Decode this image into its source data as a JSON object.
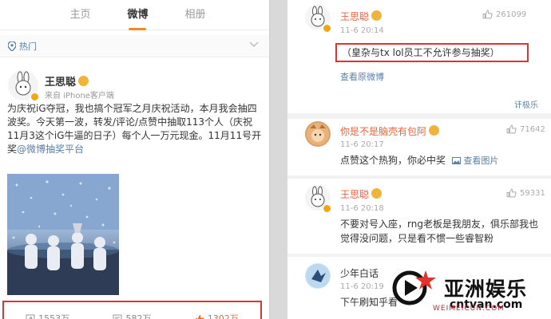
{
  "tabs": [
    "主页",
    "微博",
    "相册"
  ],
  "hot_label": "热门",
  "post": {
    "author": "王思聪",
    "source": "来自 iPhone客户端",
    "text_main": "为庆祝iG夺冠，我也搞个冠军之月庆祝活动，本月我会抽四波奖。今天第一波，转发/评论/点赞中抽取113个人（庆祝11月3这个iG牛逼的日子）每个人一万元现金。11月11号开奖",
    "text_link": "@微博抽奖平台",
    "reposts": "1553万",
    "comments": "582万",
    "likes": "1302万"
  },
  "comments": [
    {
      "name": "王思聪",
      "time": "11-6 20:14",
      "likes": "261099",
      "text": "（皇杂与tx lol员工不允许参与抽奖）",
      "link": "查看原微博"
    },
    {
      "name": "你是不是脑壳有包阿",
      "time": "11-6 20:17",
      "likes": "71642",
      "text": "点赞这个热狗，你必中奖",
      "link": "查看图片"
    },
    {
      "name": "王思聪",
      "time": "11-6 20:18",
      "likes": "59331",
      "text": "不要对号入座，rng老板是我朋友，俱乐部我也觉得没问题，只是看不惯一些睿智粉"
    },
    {
      "name": "少年白话",
      "time": "11-6 20:19",
      "likes": "",
      "text": "下午刷知乎看"
    }
  ],
  "expand_label": "讦极乐",
  "watermark": {
    "title": "亚洲娱乐",
    "url": "cntvan.com",
    "stamp": "WEIMEICUN.COM"
  },
  "colors": {
    "accent": "#f28a1f",
    "link": "#5b7fa6",
    "name": "#e8623f",
    "highlight_border": "#dd3333"
  }
}
